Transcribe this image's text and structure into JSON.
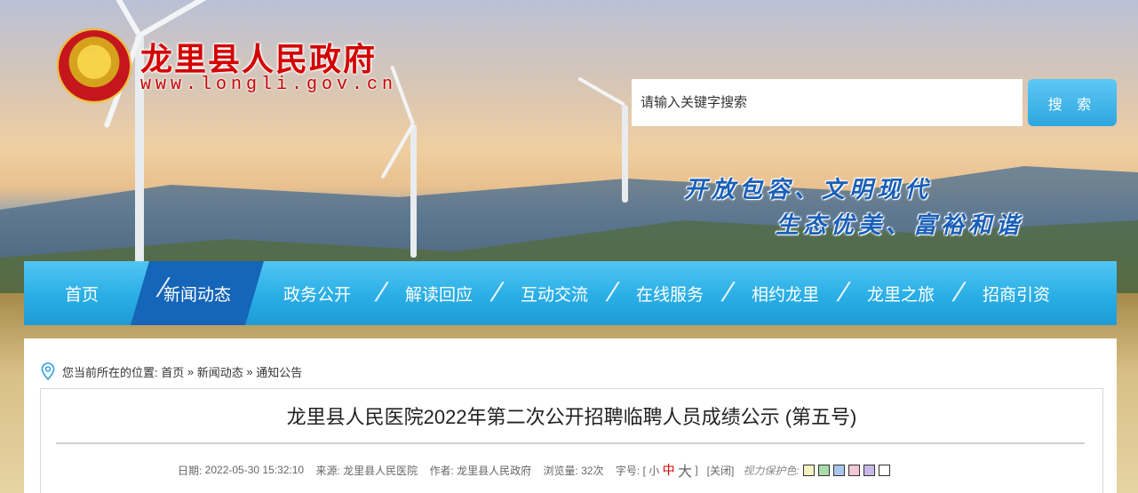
{
  "site": {
    "title": "龙里县人民政府",
    "url": "www.longli.gov.cn"
  },
  "search": {
    "placeholder": "请输入关键字搜索",
    "button_label": "搜 索"
  },
  "slogan": {
    "line1": "开放包容、文明现代",
    "line2": "生态优美、富裕和谐"
  },
  "nav": {
    "items": [
      {
        "label": "首页"
      },
      {
        "label": "新闻动态",
        "active": true
      },
      {
        "label": "政务公开"
      },
      {
        "label": "解读回应"
      },
      {
        "label": "互动交流"
      },
      {
        "label": "在线服务"
      },
      {
        "label": "相约龙里"
      },
      {
        "label": "龙里之旅"
      },
      {
        "label": "招商引资"
      }
    ]
  },
  "breadcrumb": {
    "prefix": "您当前所在的位置: ",
    "items": [
      "首页",
      "新闻动态",
      "通知公告"
    ],
    "separator": " » "
  },
  "article": {
    "title": "龙里县人民医院2022年第二次公开招聘临聘人员成绩公示 (第五号)",
    "date_label": "日期: ",
    "date": "2022-05-30 15:32:10",
    "source_label": "来源: ",
    "source": "龙里县人民医院",
    "author_label": "作者: ",
    "author": "龙里县人民政府",
    "views_label": "浏览量: ",
    "views": "32次",
    "font_size_label": "字号: [",
    "font_small": "小",
    "font_medium": "中",
    "font_large": "大",
    "font_close": "]",
    "close_label": "[关闭]",
    "eye_care_label": "视力保护色:",
    "eye_care_colors": [
      "#f5f0c0",
      "#a8dca8",
      "#a8c8f0",
      "#f0c8d8",
      "#c8b8e8",
      "#ffffff"
    ]
  },
  "colors": {
    "nav_bg": "#2aaee6",
    "nav_active": "#1565b8",
    "title_red": "#d40000",
    "slogan_blue": "#1a5fb8",
    "search_btn": "#3ab0e8"
  }
}
